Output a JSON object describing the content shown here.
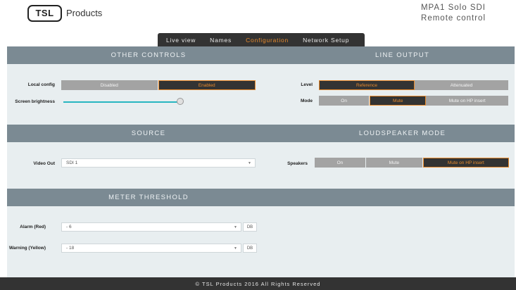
{
  "header": {
    "logo_text": "TSL",
    "brand": "Products",
    "title_line1": "MPA1 Solo SDI",
    "title_line2": "Remote control"
  },
  "tabs": [
    {
      "label": "Live view",
      "active": false
    },
    {
      "label": "Names",
      "active": false
    },
    {
      "label": "Configuration",
      "active": true
    },
    {
      "label": "Network Setup",
      "active": false
    }
  ],
  "other_controls": {
    "title": "OTHER CONTROLS",
    "local_config": {
      "label": "Local config",
      "options": [
        "Disabled",
        "Enabled"
      ],
      "selected": "Enabled"
    },
    "screen_brightness": {
      "label": "Screen brightness",
      "value_percent": 100
    }
  },
  "line_output": {
    "title": "LINE OUTPUT",
    "level": {
      "label": "Level",
      "options": [
        "Reference",
        "Attenuated"
      ],
      "selected": "Reference"
    },
    "mode": {
      "label": "Mode",
      "options": [
        "On",
        "Mute",
        "Mute on HP insert"
      ],
      "selected": "Mute"
    }
  },
  "source": {
    "title": "SOURCE",
    "video_out": {
      "label": "Video Out",
      "value": "SDI 1"
    }
  },
  "loudspeaker_mode": {
    "title": "LOUDSPEAKER MODE",
    "speakers": {
      "label": "Speakers",
      "options": [
        "On",
        "Mute",
        "Mute on HP insert"
      ],
      "selected": "Mute on HP insert"
    }
  },
  "meter_threshold": {
    "title": "METER THRESHOLD",
    "alarm": {
      "label": "Alarm (Red)",
      "value": "- 6",
      "unit": "DB"
    },
    "warning": {
      "label": "Warning (Yellow)",
      "value": "- 18",
      "unit": "DB"
    }
  },
  "footer": {
    "text": "© TSL Products 2016 All Rights Reserved"
  },
  "colors": {
    "accent": "#e78a2d",
    "band": "#7b8a93",
    "dark": "#333333",
    "slider": "#28b6c0"
  }
}
